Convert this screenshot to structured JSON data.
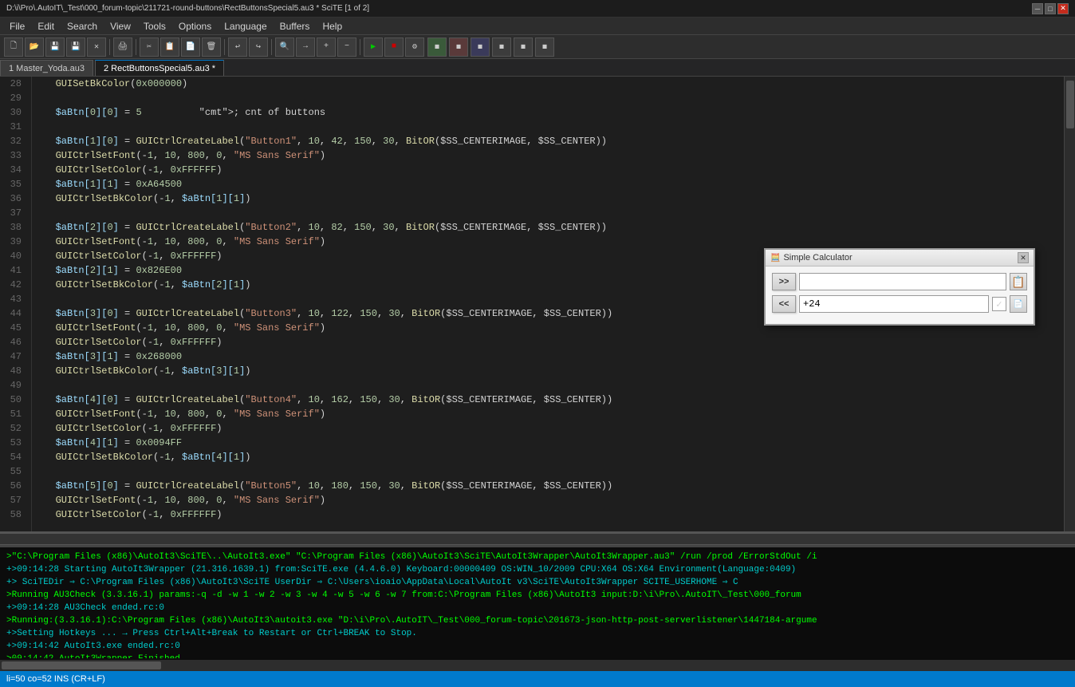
{
  "titleBar": {
    "text": "D:\\i\\Pro\\.AutoIT\\_Test\\000_forum-topic\\211721-round-buttons\\RectButtonsSpecial5.au3 * SciTE [1 of 2]",
    "minBtn": "─",
    "maxBtn": "□",
    "closeBtn": "✕"
  },
  "menuBar": {
    "items": [
      "File",
      "Edit",
      "Search",
      "View",
      "Tools",
      "Options",
      "Language",
      "Buffers",
      "Help"
    ]
  },
  "tabs": [
    {
      "label": "1 Master_Yoda.au3",
      "active": false
    },
    {
      "label": "2 RectButtonsSpecial5.au3 *",
      "active": true
    }
  ],
  "statusBar": {
    "text": "li=50 co=52 INS (CR+LF)"
  },
  "calculator": {
    "title": "Simple Calculator",
    "row1": {
      "btn": ">>",
      "input": "",
      "pasteIcon": "📋"
    },
    "row2": {
      "btn": "<<",
      "value": "+24",
      "checkmark": "✓",
      "copyIcon": "📄"
    }
  },
  "outputLines": [
    {
      "text": ">\"C:\\Program Files (x86)\\AutoIt3\\SciTE\\..\\AutoIt3.exe\" \"C:\\Program Files (x86)\\AutoIt3\\SciTE\\AutoIt3Wrapper\\AutoIt3Wrapper.au3\" /run /prod /ErrorStdOut /i",
      "type": "green"
    },
    {
      "text": "+>09:14:28 Starting AutoIt3Wrapper (21.316.1639.1) from:SciTE.exe (4.4.6.0)  Keyboard:00000409  OS:WIN_10/2009  CPU:X64 OS:X64  Environment(Language:0409)",
      "type": "cyan"
    },
    {
      "text": "+>          SciTEDir ⇒ C:\\Program Files (x86)\\AutoIt3\\SciTE   UserDir ⇒ C:\\Users\\ioaio\\AppData\\Local\\AutoIt v3\\SciTE\\AutoIt3Wrapper   SCITE_USERHOME ⇒ C",
      "type": "cyan"
    },
    {
      "text": ">Running AU3Check (3.3.16.1) params:-q -d -w 1 -w 2 -w 3 -w 4 -w 5 -w 6 -w 7  from:C:\\Program Files (x86)\\AutoIt3  input:D:\\i\\Pro\\.AutoIT\\_Test\\000_forum",
      "type": "green"
    },
    {
      "text": "+>09:14:28 AU3Check ended.rc:0",
      "type": "cyan"
    },
    {
      "text": ">Running:(3.3.16.1):C:\\Program Files (x86)\\AutoIt3\\autoit3.exe \"D:\\i\\Pro\\.AutoIT\\_Test\\000_forum-topic\\201673-json-http-post-serverlistener\\1447184-argume",
      "type": "green"
    },
    {
      "text": "+>Setting Hotkeys ... → Press Ctrl+Alt+Break to Restart or Ctrl+BREAK to Stop.",
      "type": "cyan"
    },
    {
      "text": "+>09:14:42 AutoIt3.exe ended.rc:0",
      "type": "cyan"
    },
    {
      "text": ">09:14:42 AutoIt3Wrapper Finished",
      "type": "green"
    }
  ],
  "codeLines": [
    {
      "num": "28",
      "content": "   GUISetBkColor(0x000000)"
    },
    {
      "num": "29",
      "content": ""
    },
    {
      "num": "30",
      "content": "   $aBtn[0][0] = 5          ; cnt of buttons"
    },
    {
      "num": "31",
      "content": ""
    },
    {
      "num": "32",
      "content": "   $aBtn[1][0] = GUICtrlCreateLabel(\"Button1\", 10, 42, 150, 30, BitOR($SS_CENTERIMAGE, $SS_CENTER))"
    },
    {
      "num": "33",
      "content": "   GUICtrlSetFont(-1, 10, 800, 0, \"MS Sans Serif\")"
    },
    {
      "num": "34",
      "content": "   GUICtrlSetColor(-1, 0xFFFFFF)"
    },
    {
      "num": "35",
      "content": "   $aBtn[1][1] = 0xA64500"
    },
    {
      "num": "36",
      "content": "   GUICtrlSetBkColor(-1, $aBtn[1][1])"
    },
    {
      "num": "37",
      "content": ""
    },
    {
      "num": "38",
      "content": "   $aBtn[2][0] = GUICtrlCreateLabel(\"Button2\", 10, 82, 150, 30, BitOR($SS_CENTERIMAGE, $SS_CENTER))"
    },
    {
      "num": "39",
      "content": "   GUICtrlSetFont(-1, 10, 800, 0, \"MS Sans Serif\")"
    },
    {
      "num": "40",
      "content": "   GUICtrlSetColor(-1, 0xFFFFFF)"
    },
    {
      "num": "41",
      "content": "   $aBtn[2][1] = 0x826E00"
    },
    {
      "num": "42",
      "content": "   GUICtrlSetBkColor(-1, $aBtn[2][1])"
    },
    {
      "num": "43",
      "content": ""
    },
    {
      "num": "44",
      "content": "   $aBtn[3][0] = GUICtrlCreateLabel(\"Button3\", 10, 122, 150, 30, BitOR($SS_CENTERIMAGE, $SS_CENTER))"
    },
    {
      "num": "45",
      "content": "   GUICtrlSetFont(-1, 10, 800, 0, \"MS Sans Serif\")"
    },
    {
      "num": "46",
      "content": "   GUICtrlSetColor(-1, 0xFFFFFF)"
    },
    {
      "num": "47",
      "content": "   $aBtn[3][1] = 0x268000"
    },
    {
      "num": "48",
      "content": "   GUICtrlSetBkColor(-1, $aBtn[3][1])"
    },
    {
      "num": "49",
      "content": ""
    },
    {
      "num": "50",
      "content": "   $aBtn[4][0] = GUICtrlCreateLabel(\"Button4\", 10, 162, 150, 30, BitOR($SS_CENTERIMAGE, $SS_CENTER))"
    },
    {
      "num": "51",
      "content": "   GUICtrlSetFont(-1, 10, 800, 0, \"MS Sans Serif\")"
    },
    {
      "num": "52",
      "content": "   GUICtrlSetColor(-1, 0xFFFFFF)"
    },
    {
      "num": "53",
      "content": "   $aBtn[4][1] = 0x0094FF"
    },
    {
      "num": "54",
      "content": "   GUICtrlSetBkColor(-1, $aBtn[4][1])"
    },
    {
      "num": "55",
      "content": ""
    },
    {
      "num": "56",
      "content": "   $aBtn[5][0] = GUICtrlCreateLabel(\"Button5\", 10, 180, 150, 30, BitOR($SS_CENTERIMAGE, $SS_CENTER))"
    },
    {
      "num": "57",
      "content": "   GUICtrlSetFont(-1, 10, 800, 0, \"MS Sans Serif\")"
    },
    {
      "num": "58",
      "content": "   GUICtrlSetColor(-1, 0xFFFFFF)"
    }
  ]
}
